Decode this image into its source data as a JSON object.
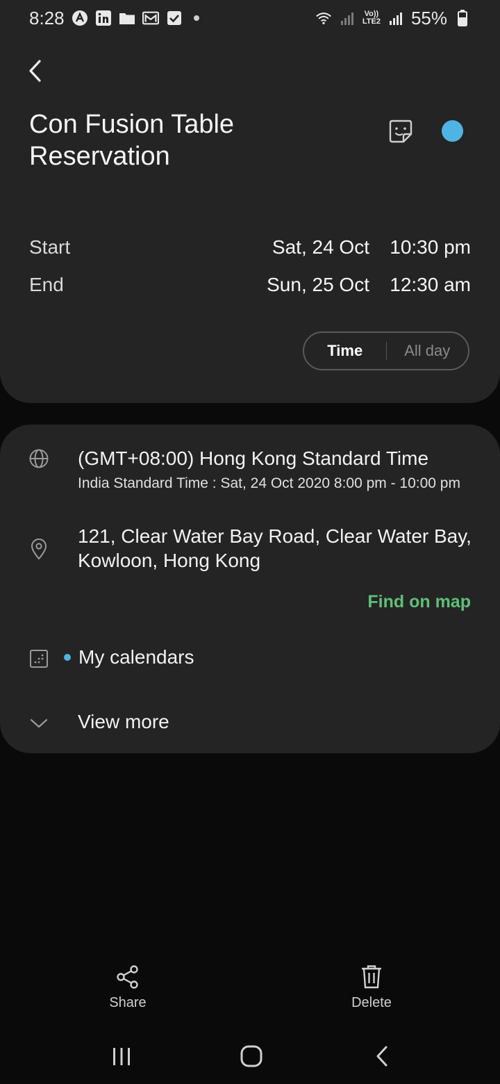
{
  "status_bar": {
    "time": "8:28",
    "battery": "55%",
    "network_label_top": "Vo))",
    "network_label_bottom": "LTE2"
  },
  "event": {
    "title": "Con Fusion Table Reservation",
    "color": "#4fb3e3"
  },
  "schedule": {
    "start_label": "Start",
    "start_date": "Sat, 24 Oct",
    "start_time": "10:30 pm",
    "end_label": "End",
    "end_date": "Sun, 25 Oct",
    "end_time": "12:30 am"
  },
  "mode_toggle": {
    "time_label": "Time",
    "all_day_label": "All day",
    "selected": "Time"
  },
  "details": {
    "timezone": "(GMT+08:00) Hong Kong Standard Time",
    "timezone_local": "India Standard Time : Sat, 24 Oct 2020 8:00 pm - 10:00 pm",
    "location": "121, Clear Water Bay Road, Clear Water Bay, Kowloon, Hong Kong",
    "find_on_map": "Find on map",
    "calendar": "My calendars",
    "view_more": "View more"
  },
  "actions": {
    "share": "Share",
    "delete": "Delete"
  },
  "colors": {
    "accent_green": "#5fbf78",
    "event_blue": "#4fb3e3"
  }
}
